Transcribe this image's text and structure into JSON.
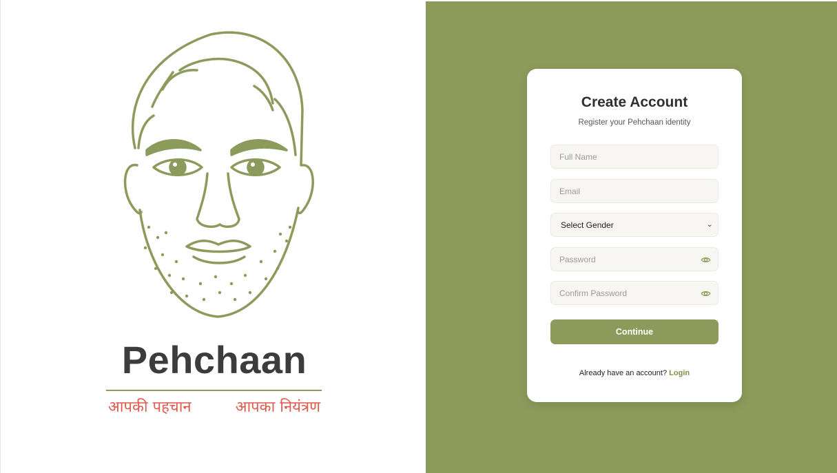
{
  "brand": {
    "name": "Pehchaan",
    "tagline_left": "आपकी पहचान",
    "tagline_right": "आपका नियंत्रण"
  },
  "colors": {
    "accent": "#8c9a5b",
    "tagline": "#e05a4e",
    "link": "#7f9144"
  },
  "form": {
    "title": "Create Account",
    "subtitle": "Register your Pehchaan identity",
    "full_name_placeholder": "Full Name",
    "email_placeholder": "Email",
    "gender_selected": "Select Gender",
    "password_placeholder": "Password",
    "confirm_password_placeholder": "Confirm Password",
    "continue_label": "Continue",
    "login_prompt": "Already have an account?",
    "login_label": "Login"
  },
  "icons": {
    "logo": "face-illustration-icon",
    "select_arrow": "chevron-down-icon",
    "password_toggle": "eye-icon"
  }
}
